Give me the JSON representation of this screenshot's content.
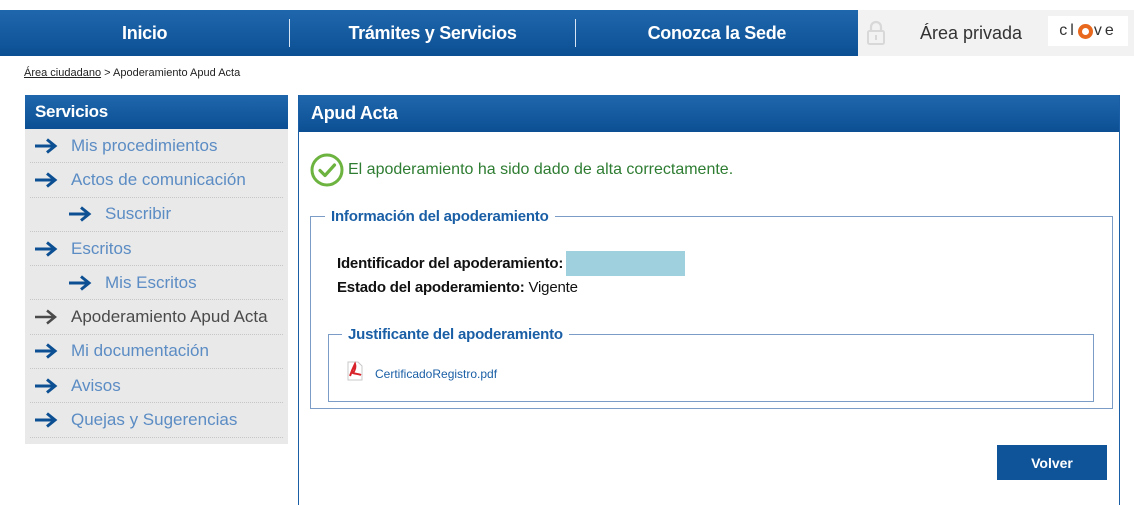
{
  "nav": {
    "items": [
      {
        "label": "Inicio"
      },
      {
        "label": "Trámites y Servicios"
      },
      {
        "label": "Conozca la Sede"
      }
    ],
    "private_area_label": "Área privada",
    "logo_text": "cl ve"
  },
  "breadcrumb": {
    "link": "Área ciudadano",
    "separator": ">",
    "current": "Apoderamiento Apud Acta"
  },
  "sidebar": {
    "title": "Servicios",
    "items": [
      {
        "label": "Mis procedimientos",
        "level": 0
      },
      {
        "label": "Actos de comunicación",
        "level": 0
      },
      {
        "label": "Suscribir",
        "level": 1
      },
      {
        "label": "Escritos",
        "level": 0
      },
      {
        "label": "Mis Escritos",
        "level": 1
      },
      {
        "label": "Apoderamiento Apud Acta",
        "level": 0,
        "active": true
      },
      {
        "label": "Mi documentación",
        "level": 0
      },
      {
        "label": "Avisos",
        "level": 0
      },
      {
        "label": "Quejas y Sugerencias",
        "level": 0
      }
    ]
  },
  "main": {
    "title": "Apud Acta",
    "success_message": "El apoderamiento ha sido dado de alta correctamente.",
    "info": {
      "legend": "Información del apoderamiento",
      "id_label": "Identificador del apoderamiento:",
      "id_value": "",
      "status_label": "Estado del apoderamiento:",
      "status_value": "Vigente"
    },
    "justificante": {
      "legend": "Justificante del apoderamiento",
      "file_name": "CertificadoRegistro.pdf"
    },
    "back_button": "Volver"
  },
  "colors": {
    "brand_blue": "#0c4f93",
    "link_blue": "#5b8cc4",
    "success_green": "#2e7d32",
    "pdf_red": "#d8232a"
  }
}
